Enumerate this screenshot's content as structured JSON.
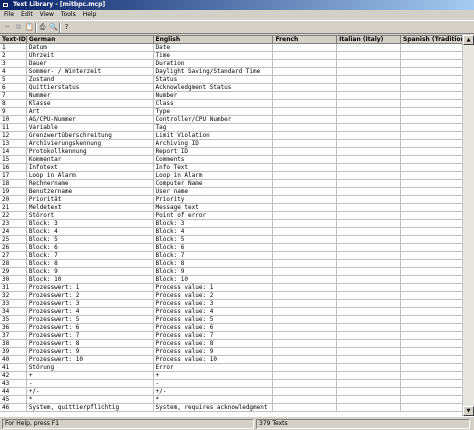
{
  "window": {
    "title": "Text Library - [mitbpc.mcp]"
  },
  "menu": [
    "File",
    "Edit",
    "View",
    "Tools",
    "Help"
  ],
  "toolbar": [
    {
      "icon": "cut-icon",
      "glyph": "✂",
      "enabled": false
    },
    {
      "icon": "copy-icon",
      "glyph": "⧉",
      "enabled": false
    },
    {
      "icon": "paste-icon",
      "glyph": "📋",
      "enabled": false
    },
    {
      "icon": "print-icon",
      "glyph": "⎙",
      "enabled": true
    },
    {
      "icon": "print-preview-icon",
      "glyph": "🔍",
      "enabled": true
    },
    {
      "icon": "help-icon",
      "glyph": "?",
      "enabled": true
    }
  ],
  "grid": {
    "columns": [
      "Text-ID",
      "German",
      "English",
      "French",
      "Italian (Italy)",
      "Spanish (Traditional"
    ],
    "rows": [
      [
        "1",
        "Datum",
        "Date",
        "",
        "",
        ""
      ],
      [
        "2",
        "Uhrzeit",
        "Time",
        "",
        "",
        ""
      ],
      [
        "3",
        "Dauer",
        "Duration",
        "",
        "",
        ""
      ],
      [
        "4",
        "Sommer- /  Winterzeit",
        "Daylight Saving/Standard Time",
        "",
        "",
        ""
      ],
      [
        "5",
        "Zustand",
        "Status",
        "",
        "",
        ""
      ],
      [
        "6",
        "Quittierstatus",
        "Acknowledgment Status",
        "",
        "",
        ""
      ],
      [
        "7",
        "Nummer",
        "Number",
        "",
        "",
        ""
      ],
      [
        "8",
        "Klasse",
        "Class",
        "",
        "",
        ""
      ],
      [
        "9",
        "Art",
        "Type",
        "",
        "",
        ""
      ],
      [
        "10",
        "AG/CPU-Nummer",
        "Controller/CPU Number",
        "",
        "",
        ""
      ],
      [
        "11",
        "Variable",
        "Tag",
        "",
        "",
        ""
      ],
      [
        "12",
        "Grenzwertüberschreitung",
        "Limit Violation",
        "",
        "",
        ""
      ],
      [
        "13",
        "Archivierungskennung",
        "Archiving ID",
        "",
        "",
        ""
      ],
      [
        "14",
        "Protokollkennung",
        "Report ID",
        "",
        "",
        ""
      ],
      [
        "15",
        "Kommentar",
        "Comments",
        "",
        "",
        ""
      ],
      [
        "16",
        "Infotext",
        "Info Text",
        "",
        "",
        ""
      ],
      [
        "17",
        "Loop in Alarm",
        "Loop in Alarm",
        "",
        "",
        ""
      ],
      [
        "18",
        "Rechnername",
        "Computer Name",
        "",
        "",
        ""
      ],
      [
        "19",
        "Benutzername",
        "User name",
        "",
        "",
        ""
      ],
      [
        "20",
        "Priorität",
        "Priority",
        "",
        "",
        ""
      ],
      [
        "21",
        "Meldetext",
        "Message text",
        "",
        "",
        ""
      ],
      [
        "22",
        "Störort",
        "Point of error",
        "",
        "",
        ""
      ],
      [
        "23",
        "Block:  3",
        "Block:  3",
        "",
        "",
        ""
      ],
      [
        "24",
        "Block:  4",
        "Block:  4",
        "",
        "",
        ""
      ],
      [
        "25",
        "Block:  5",
        "Block:  5",
        "",
        "",
        ""
      ],
      [
        "26",
        "Block:  6",
        "Block:  6",
        "",
        "",
        ""
      ],
      [
        "27",
        "Block:  7",
        "Block:  7",
        "",
        "",
        ""
      ],
      [
        "28",
        "Block:  8",
        "Block:  8",
        "",
        "",
        ""
      ],
      [
        "29",
        "Block:  9",
        "Block:  9",
        "",
        "",
        ""
      ],
      [
        "30",
        "Block: 10",
        "Block: 10",
        "",
        "",
        ""
      ],
      [
        "31",
        "Prozesswert:  1",
        "Process value:  1",
        "",
        "",
        ""
      ],
      [
        "32",
        "Prozesswert:  2",
        "Process value:  2",
        "",
        "",
        ""
      ],
      [
        "33",
        "Prozesswert:  3",
        "Process value:  3",
        "",
        "",
        ""
      ],
      [
        "34",
        "Prozesswert:  4",
        "Process value:  4",
        "",
        "",
        ""
      ],
      [
        "35",
        "Prozesswert:  5",
        "Process value:  5",
        "",
        "",
        ""
      ],
      [
        "36",
        "Prozesswert:  6",
        "Process value:  6",
        "",
        "",
        ""
      ],
      [
        "37",
        "Prozesswert:  7",
        "Process value:  7",
        "",
        "",
        ""
      ],
      [
        "38",
        "Prozesswert:  8",
        "Process value:  8",
        "",
        "",
        ""
      ],
      [
        "39",
        "Prozesswert:  9",
        "Process value:  9",
        "",
        "",
        ""
      ],
      [
        "40",
        "Prozesswert: 10",
        "Process value: 10",
        "",
        "",
        ""
      ],
      [
        "41",
        "Störung",
        "Error",
        "",
        "",
        ""
      ],
      [
        "42",
        "+",
        "+",
        "",
        "",
        ""
      ],
      [
        "43",
        "-",
        "-",
        "",
        "",
        ""
      ],
      [
        "44",
        "+/-",
        "+/-",
        "",
        "",
        ""
      ],
      [
        "45",
        "*",
        "*",
        "",
        "",
        ""
      ],
      [
        "46",
        "System, quittierpflichtig",
        "System, requires acknowledgment",
        "",
        "",
        ""
      ]
    ]
  },
  "status": {
    "left": "For Help, press F1",
    "count": "379 Texts"
  }
}
